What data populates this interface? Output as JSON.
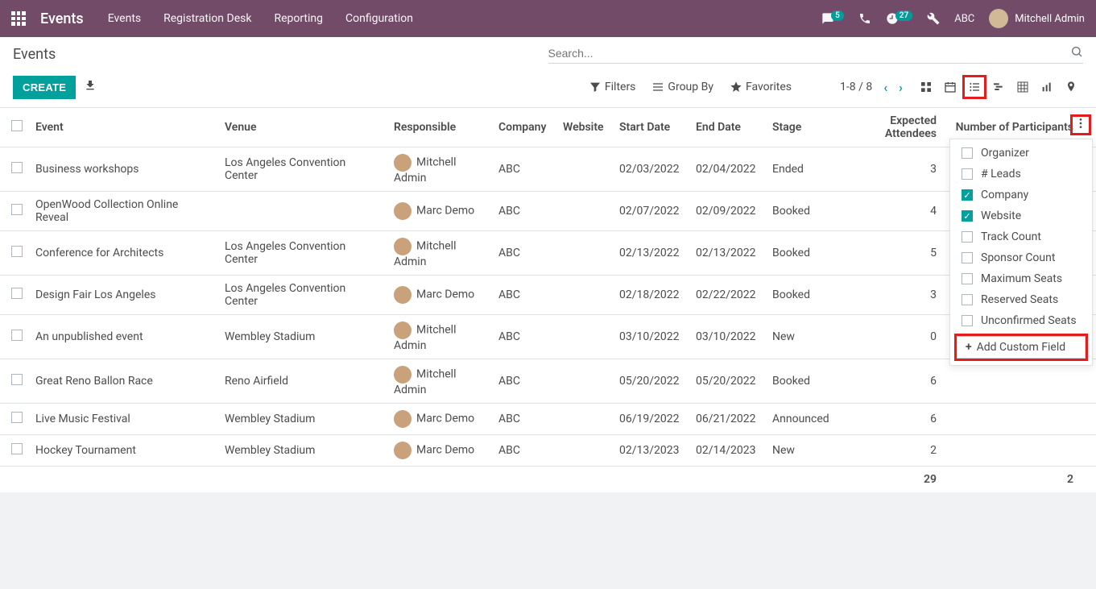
{
  "navbar": {
    "app_title": "Events",
    "links": [
      "Events",
      "Registration Desk",
      "Reporting",
      "Configuration"
    ],
    "messages_badge": "5",
    "activities_badge": "27",
    "company": "ABC",
    "user_name": "Mitchell Admin"
  },
  "control_panel": {
    "breadcrumb": "Events",
    "search_placeholder": "Search...",
    "create_label": "CREATE",
    "filters_label": "Filters",
    "group_by_label": "Group By",
    "favorites_label": "Favorites",
    "pager": "1-8 / 8"
  },
  "columns": {
    "event": "Event",
    "venue": "Venue",
    "responsible": "Responsible",
    "company": "Company",
    "website": "Website",
    "start": "Start Date",
    "end": "End Date",
    "stage": "Stage",
    "expected": "Expected Attendees",
    "participants": "Number of Participants"
  },
  "rows": [
    {
      "event": "Business workshops",
      "venue": "Los Angeles Convention Center",
      "responsible": "Mitchell Admin",
      "company": "ABC",
      "website": "",
      "start": "02/03/2022",
      "end": "02/04/2022",
      "stage": "Ended",
      "expected": "3",
      "participants": ""
    },
    {
      "event": "OpenWood Collection Online Reveal",
      "venue": "",
      "responsible": "Marc Demo",
      "company": "ABC",
      "website": "",
      "start": "02/07/2022",
      "end": "02/09/2022",
      "stage": "Booked",
      "expected": "4",
      "participants": ""
    },
    {
      "event": "Conference for Architects",
      "venue": "Los Angeles Convention Center",
      "responsible": "Mitchell Admin",
      "company": "ABC",
      "website": "",
      "start": "02/13/2022",
      "end": "02/13/2022",
      "stage": "Booked",
      "expected": "5",
      "participants": ""
    },
    {
      "event": "Design Fair Los Angeles",
      "venue": "Los Angeles Convention Center",
      "responsible": "Marc Demo",
      "company": "ABC",
      "website": "",
      "start": "02/18/2022",
      "end": "02/22/2022",
      "stage": "Booked",
      "expected": "3",
      "participants": ""
    },
    {
      "event": "An unpublished event",
      "venue": "Wembley Stadium",
      "responsible": "Mitchell Admin",
      "company": "ABC",
      "website": "",
      "start": "03/10/2022",
      "end": "03/10/2022",
      "stage": "New",
      "expected": "0",
      "participants": ""
    },
    {
      "event": "Great Reno Ballon Race",
      "venue": "Reno Airfield",
      "responsible": "Mitchell Admin",
      "company": "ABC",
      "website": "",
      "start": "05/20/2022",
      "end": "05/20/2022",
      "stage": "Booked",
      "expected": "6",
      "participants": ""
    },
    {
      "event": "Live Music Festival",
      "venue": "Wembley Stadium",
      "responsible": "Marc Demo",
      "company": "ABC",
      "website": "",
      "start": "06/19/2022",
      "end": "06/21/2022",
      "stage": "Announced",
      "expected": "6",
      "participants": ""
    },
    {
      "event": "Hockey Tournament",
      "venue": "Wembley Stadium",
      "responsible": "Marc Demo",
      "company": "ABC",
      "website": "",
      "start": "02/13/2023",
      "end": "02/14/2023",
      "stage": "New",
      "expected": "2",
      "participants": ""
    }
  ],
  "totals": {
    "expected": "29",
    "participants": "2"
  },
  "col_menu": {
    "items": [
      {
        "label": "Organizer",
        "checked": false
      },
      {
        "label": "# Leads",
        "checked": false
      },
      {
        "label": "Company",
        "checked": true
      },
      {
        "label": "Website",
        "checked": true
      },
      {
        "label": "Track Count",
        "checked": false
      },
      {
        "label": "Sponsor Count",
        "checked": false
      },
      {
        "label": "Maximum Seats",
        "checked": false
      },
      {
        "label": "Reserved Seats",
        "checked": false
      },
      {
        "label": "Unconfirmed Seats",
        "checked": false
      }
    ],
    "add_label": "Add Custom Field"
  }
}
